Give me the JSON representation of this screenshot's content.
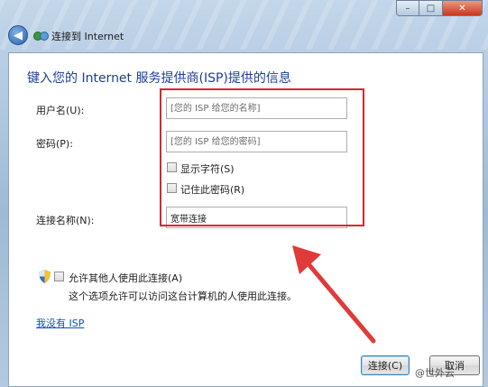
{
  "window": {
    "title": "连接到 Internet",
    "caption": {
      "minimize": "–",
      "maximize": "□",
      "close": "✕"
    }
  },
  "back_icon_glyph": "◀",
  "content": {
    "heading": "键入您的 Internet 服务提供商(ISP)提供的信息",
    "fields": {
      "username": {
        "label": "用户名(U):",
        "placeholder": "[您的 ISP 给您的名称]",
        "value": ""
      },
      "password": {
        "label": "密码(P):",
        "placeholder": "[您的 ISP 给您的密码]",
        "value": ""
      },
      "connection_name": {
        "label": "连接名称(N):",
        "value": "宽带连接"
      }
    },
    "checkboxes": {
      "show_chars": {
        "label": "显示字符(S)",
        "checked": false
      },
      "remember_password": {
        "label": "记住此密码(R)",
        "checked": false
      },
      "allow_others": {
        "label": "允许其他人使用此连接(A)",
        "checked": false
      }
    },
    "allow_others_note": "这个选项允许可以访问这台计算机的人使用此连接。",
    "no_isp_link": "我没有 ISP"
  },
  "buttons": {
    "connect": "连接(C)",
    "cancel": "取消"
  },
  "watermark": "@世外云",
  "colors": {
    "highlight": "#d9262d",
    "heading": "#1c3f95",
    "link": "#0b4fb8",
    "arrow": "#e03a3a"
  }
}
